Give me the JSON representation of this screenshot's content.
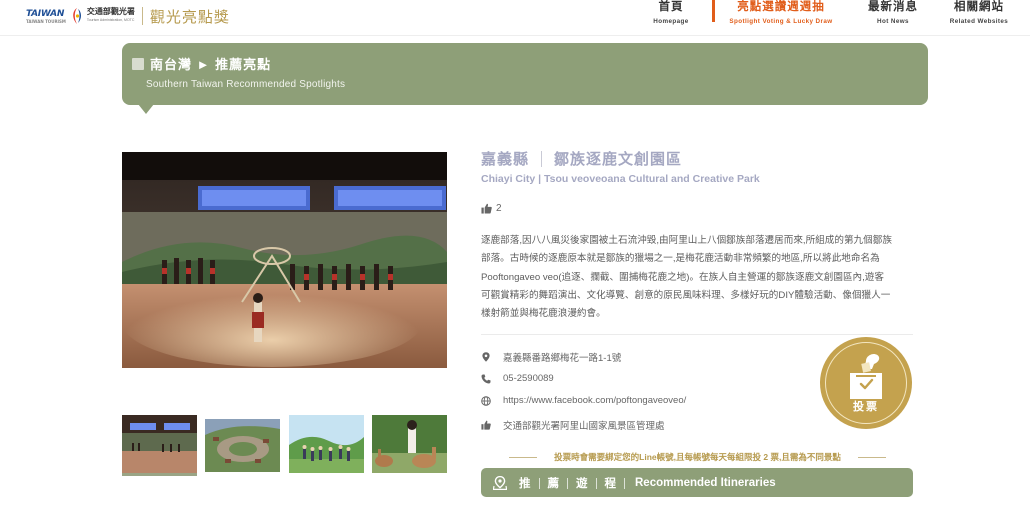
{
  "header": {
    "logo_taiwan": "TAIWAN",
    "logo_taiwan_sub": "TAIWAN TOURISM",
    "logo_org": "交通部觀光署",
    "logo_org_sub": "Tourism Administration, MOTC",
    "brand": "觀光亮點獎",
    "nav": [
      {
        "zh": "首頁",
        "en": "Homepage"
      },
      {
        "zh": "亮點選讚週週抽",
        "en": "Spotlight Voting & Lucky Draw"
      },
      {
        "zh": "最新消息",
        "en": "Hot News"
      },
      {
        "zh": "相關網站",
        "en": "Related Websites"
      }
    ],
    "active_nav": 1
  },
  "banner": {
    "title": "南台灣 ► 推薦亮點",
    "subtitle": "Southern Taiwan Recommended Spotlights"
  },
  "spot": {
    "city": "嘉義縣",
    "name": "鄒族逐鹿文創園區",
    "subtitle": "Chiayi City | Tsou veoveoana Cultural and Creative Park",
    "likes": "2",
    "description": [
      "逐鹿部落,因八八風災後家園被土石流沖毀,由阿里山上八個鄒族部落遷居而來,所組成的第九個鄒族",
      "部落。古時候的逐鹿原本就是鄒族的獵場之一,是梅花鹿活動非常頻繁的地區,所以將此地命名為",
      "Pooftongaveo veo(追逐、攔截、圍捕梅花鹿之地)。在族人自主營運的鄒族逐鹿文創園區內,遊客",
      "可觀賞精彩的舞蹈演出、文化導覽、創意的原民風味料理、多樣好玩的DIY體驗活動、像個獵人一",
      "樣射箭並與梅花鹿浪漫約會。"
    ],
    "address": "嘉義縣番路鄉梅花一路1-1號",
    "phone": "05-2590089",
    "website": "https://www.facebook.com/poftongaveoveo/",
    "organizer": "交通部觀光署阿里山國家風景區管理處"
  },
  "vote": {
    "label": "投票"
  },
  "notice": "投票時會需要綁定您的Line帳號,且每帳號每天每組限投 2 票,且需為不同景點",
  "itinerary": {
    "zh_chars": [
      "推",
      "薦",
      "遊",
      "程"
    ],
    "en": "Recommended Itineraries"
  },
  "colors": {
    "accent": "#e15d1a",
    "olive": "#8e9f78",
    "gold": "#c4a24e",
    "title_lavender": "#a5a8c2"
  },
  "icons": {
    "likes": "thumbs-up-icon",
    "address": "map-pin-icon",
    "phone": "phone-icon",
    "website": "globe-icon",
    "organizer": "thumbs-up-icon",
    "vote": "ballot-box-icon",
    "itinerary": "map-marker-icon"
  }
}
